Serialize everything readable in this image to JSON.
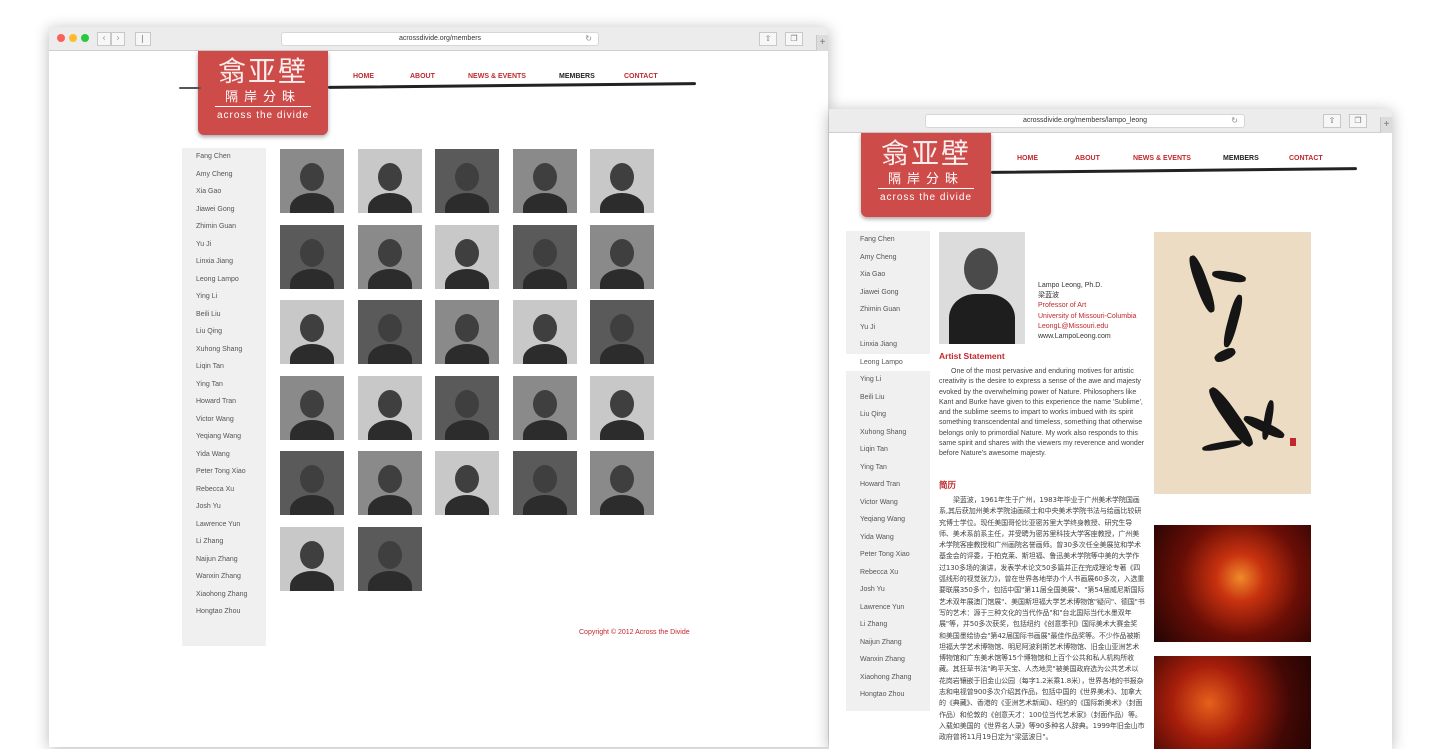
{
  "browser_left": {
    "url": "acrossdivide.org/members"
  },
  "browser_right": {
    "url": "acrossdivide.org/members/lampo_leong"
  },
  "logo": {
    "seal": "翕亚壁",
    "chinese": "隔岸分昧",
    "english": "across  the  divide"
  },
  "nav": {
    "home": "HOME",
    "about": "ABOUT",
    "news": "NEWS & EVENTS",
    "members": "MEMBERS",
    "contact": "CONTACT"
  },
  "members": [
    "Fang Chen",
    "Amy Cheng",
    "Xia Gao",
    "Jiawei Gong",
    "Zhimin Guan",
    "Yu Ji",
    "Linxia Jiang",
    "Leong Lampo",
    "Ying Li",
    "Beili Liu",
    "Liu Qing",
    "Xuhong Shang",
    "Liqin Tan",
    "Ying Tan",
    "Howard Tran",
    "Victor Wang",
    "Yeqiang Wang",
    "Yida Wang",
    "Peter Tong Xiao",
    "Rebecca Xu",
    "Josh Yu",
    "Lawrence Yun",
    "Li Zhang",
    "Naijun Zhang",
    "Wanxin Zhang",
    "Xiaohong Zhang",
    "Hongtao Zhou"
  ],
  "copyright": "Copyright © 2012 Across the Divide",
  "profile": {
    "name": "Lampo Leong, Ph.D.",
    "name_cn": "梁蓝波",
    "title": "Professor of Art",
    "university": "University of Missouri-Columbia",
    "email": "LeongL@Missouri.edu",
    "website": "www.LampoLeong.com",
    "statement_heading": "Artist Statement",
    "statement": "One of the most pervasive and enduring motives for artistic creativity is the desire to express a sense of the awe and majesty evoked by the overwhelming power of Nature. Philosophers like Kant and Burke have given to this experience the name 'Sublime', and the sublime seems to impart to works imbued with its spirit something transcendental and timeless, something that otherwise belongs only to primordial Nature. My work also responds to this same spirit and shares with the viewers my reverence and wonder before Nature's awesome majesty.",
    "bio_heading": "简历",
    "bio": "梁蓝波，1961年生于广州，1983年毕业于广州美术学院国画系,其后获加州美术学院油画硕士和中央美术学院书法与绘画比较研究博士学位。现任美国哥伦比亚密苏里大学终身教授、研究生导师、美术系前系主任，并受聘为密苏里科技大学客座教授，广州美术学院客座教授和广州画院名誉画师。曾30多次任全美展览和学术基金会的评委，于柏克莱、斯坦福、鲁迅美术学院等中美的大学作过130多场的演讲，发表学术论文50多篇并正在完成理论专著《四弧线形的视觉张力》，曾在世界各地举办个人书画展60多次，入选重要联展350多个，包括中国\"第11届全国美展\"、\"第54届威尼斯国际艺术双年展澳门馆展\"、美国斯坦福大学艺术博物馆\"疑问\"、德国\"书写的艺术：源于三种文化的当代作品\"和\"台北国际当代水墨双年展\"等，并50多次获奖，包括纽约《创意季刊》国际美术大赛金奖 和美国墨绘协会\"第42届国际书画展\"最佳作品奖等。不少作品被斯坦福大学艺术博物馆、明尼阿波利斯艺术博物馆、旧金山亚洲艺术博物馆和广东美术馆等15个博物馆和上百个公共和私人机构所收藏。其狂草书法\"昫平天宝、人杰地灵\"被美国政府选为公共艺术以花岗岩镶嵌于旧金山公园（每字1.2米乘1.8米），世界各地的书报杂志和电视曾900多次介绍其作品，包括中国的《世界美术》、加拿大的《典藏》、香港的《亚洲艺术新闻》、纽约的《国际新美术》（封面作品）和伦敦的《创意天才：100位当代艺术家》（封面作品）等。入载如美国的《世界名人录》等90多种名人辞典。1999年旧金山市政府曾将11月19日定为\"梁蓝波日\"。"
  }
}
